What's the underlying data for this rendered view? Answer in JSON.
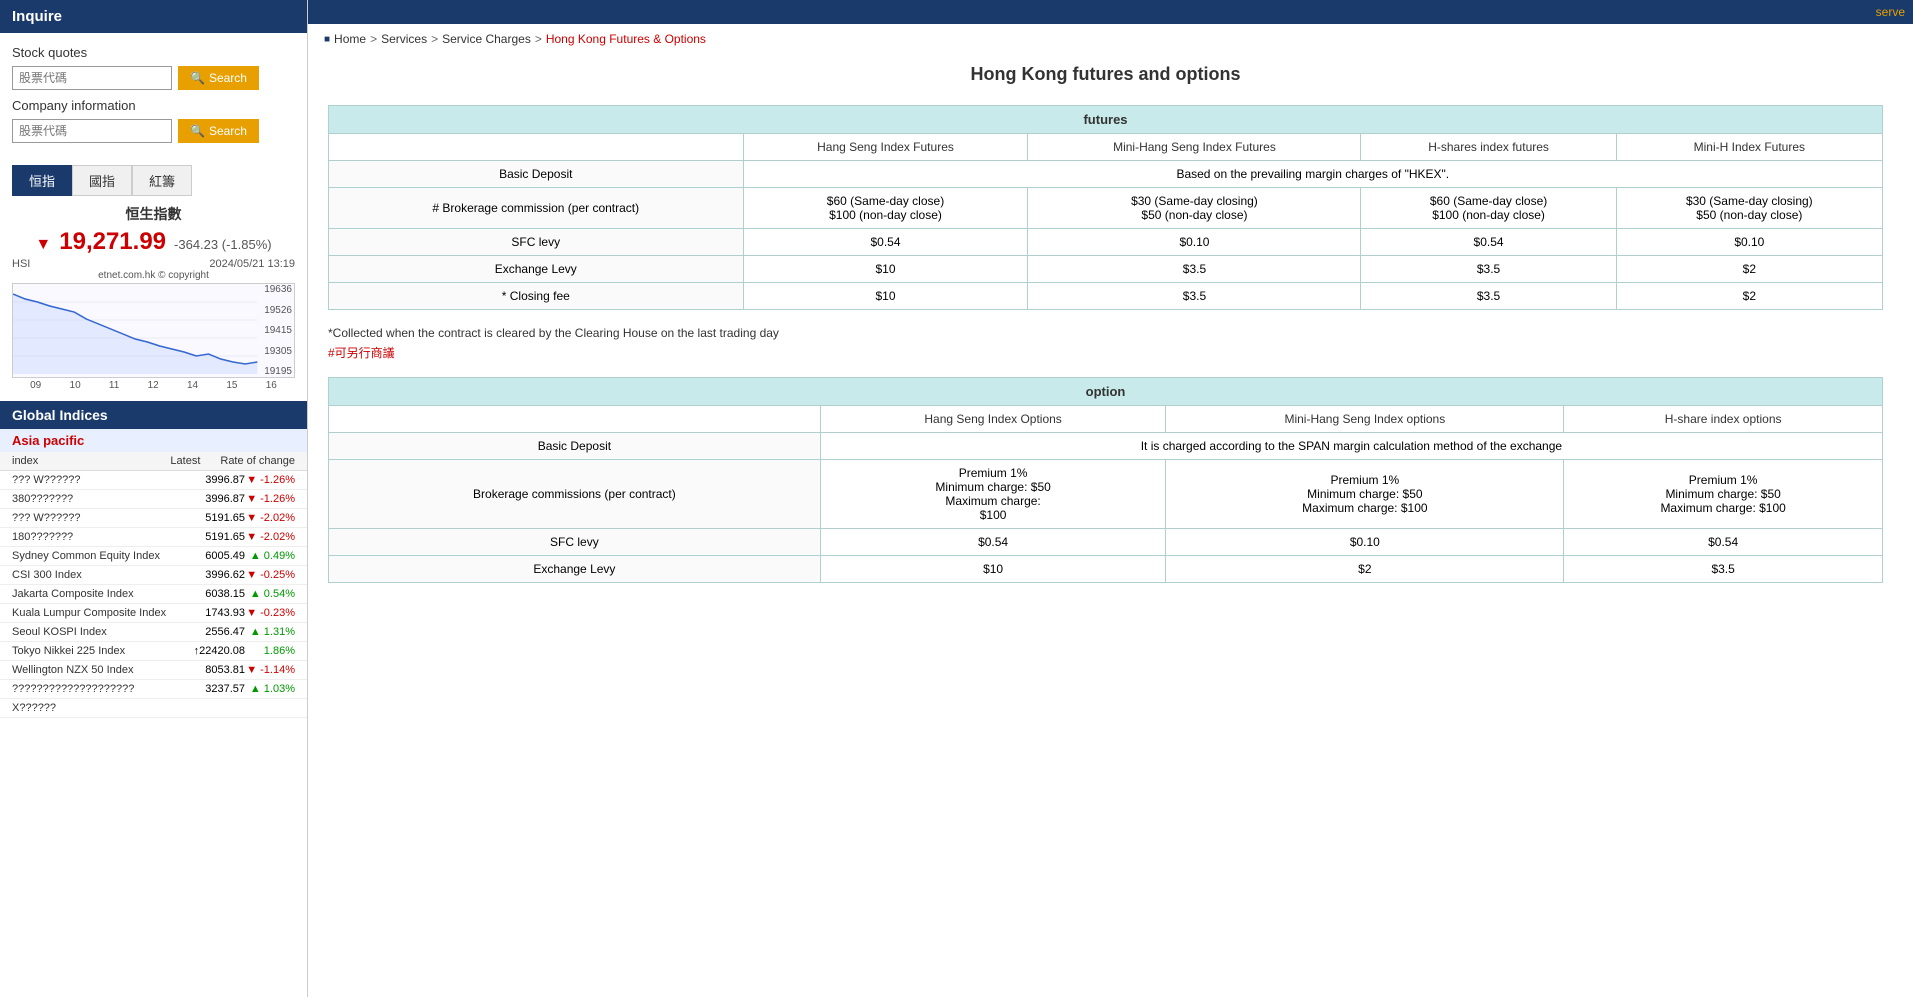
{
  "sidebar": {
    "inquire_label": "Inquire",
    "stock_quotes_label": "Stock quotes",
    "stock_input_placeholder": "股票代碼",
    "company_info_label": "Company information",
    "company_input_placeholder": "股票代碼",
    "search_label": "Search",
    "tabs": [
      {
        "id": "hsi",
        "label": "恒指",
        "active": true
      },
      {
        "id": "hsi2",
        "label": "國指"
      },
      {
        "id": "red",
        "label": "紅籌"
      }
    ],
    "stock_name": "恒生指數",
    "stock_price": "19,271.99",
    "stock_change": "-364.23 (-1.85%)",
    "stock_code": "HSI",
    "stock_date": "2024/05/21 13:19",
    "stock_copyright": "etnet.com.hk © copyright",
    "chart_y_labels": [
      "19636",
      "19526",
      "19415",
      "19305",
      "19195"
    ],
    "chart_x_labels": [
      "09",
      "10",
      "11",
      "12",
      "14",
      "15",
      "16"
    ],
    "global_indices_label": "Global Indices",
    "asia_pacific_label": "Asia pacific",
    "indices_col_index": "index",
    "indices_col_latest": "Latest",
    "indices_col_rate": "Rate of change",
    "indices": [
      {
        "name": "??? W??????",
        "value": "3996.87",
        "change": "-1.26%",
        "direction": "down"
      },
      {
        "name": "380??????",
        "value": "3996.87",
        "change": "-1.26%",
        "direction": "down"
      },
      {
        "name": "??? W??????",
        "value": "5191.65",
        "change": "-2.02%",
        "direction": "down"
      },
      {
        "name": "180???????",
        "value": "5191.65",
        "change": "-2.02%",
        "direction": "down"
      },
      {
        "name": "Sydney Common Equity Index",
        "value": "6005.49",
        "change": "0.49%",
        "direction": "up"
      },
      {
        "name": "CSI 300 Index",
        "value": "3996.62",
        "change": "-0.25%",
        "direction": "down"
      },
      {
        "name": "Jakarta Composite Index",
        "value": "6038.15",
        "change": "0.54%",
        "direction": "up"
      },
      {
        "name": "Kuala Lumpur Composite Index",
        "value": "1743.93",
        "change": "-0.23%",
        "direction": "down"
      },
      {
        "name": "Seoul KOSPI Index",
        "value": "2556.47",
        "change": "1.31%",
        "direction": "up"
      },
      {
        "name": "Tokyo Nikkei 225 Index",
        "value": "22420.08",
        "change": "1.86%",
        "direction": "up"
      },
      {
        "name": "Wellington NZX 50 Index",
        "value": "8053.81",
        "change": "-1.14%",
        "direction": "down"
      },
      {
        "name": "????????????????????",
        "value": "3237.57",
        "change": "1.03%",
        "direction": "up"
      },
      {
        "name": "X??????",
        "value": "",
        "change": "",
        "direction": ""
      }
    ]
  },
  "topnav": {
    "serve_label": "serve"
  },
  "breadcrumb": {
    "home": "Home",
    "services": "Services",
    "service_charges": "Service Charges",
    "current": "Hong Kong Futures & Options"
  },
  "main": {
    "page_title": "Hong Kong futures and options",
    "futures_table": {
      "header": "futures",
      "columns": [
        "",
        "Hang Seng Index Futures",
        "Mini-Hang Seng Index Futures",
        "H-shares index futures",
        "Mini-H Index Futures"
      ],
      "rows": [
        {
          "label": "Basic Deposit",
          "values": [
            "Based on the prevailing margin charges of \"HKEX\"."
          ],
          "colspan": 4
        },
        {
          "label": "# Brokerage commission (per contract)",
          "values": [
            "$60 (Same-day close)\n$100 (non-day close)",
            "$30 (Same-day closing)\n$50 (non-day close)",
            "$60 (Same-day close)\n$100 (non-day close)",
            "$30 (Same-day closing)\n$50 (non-day close)"
          ]
        },
        {
          "label": "SFC levy",
          "values": [
            "$0.54",
            "$0.10",
            "$0.54",
            "$0.10"
          ]
        },
        {
          "label": "Exchange Levy",
          "values": [
            "$10",
            "$3.5",
            "$3.5",
            "$2"
          ]
        },
        {
          "label": "* Closing fee",
          "values": [
            "$10",
            "$3.5",
            "$3.5",
            "$2"
          ]
        }
      ]
    },
    "futures_note1": "*Collected when the contract is cleared by the Clearing House on the last trading day",
    "futures_note2": "#可另行商議",
    "options_table": {
      "header": "option",
      "columns": [
        "",
        "Hang Seng Index Options",
        "Mini-Hang Seng Index options",
        "H-share index options"
      ],
      "rows": [
        {
          "label": "Basic Deposit",
          "values": [
            "It is charged according to the SPAN margin calculation method of the exchange"
          ],
          "colspan": 3
        },
        {
          "label": "Brokerage commissions (per contract)",
          "values": [
            "Premium 1%\nMinimum charge: $50\nMaximum charge:\n$100",
            "Premium 1%\nMinimum charge: $50\nMaximum charge: $100",
            "Premium 1%\nMinimum charge: $50\nMaximum charge: $100"
          ]
        },
        {
          "label": "SFC levy",
          "values": [
            "$0.54",
            "$0.10",
            "$0.54"
          ]
        },
        {
          "label": "Exchange Levy",
          "values": [
            "$10",
            "$2",
            "$3.5"
          ]
        }
      ]
    }
  }
}
